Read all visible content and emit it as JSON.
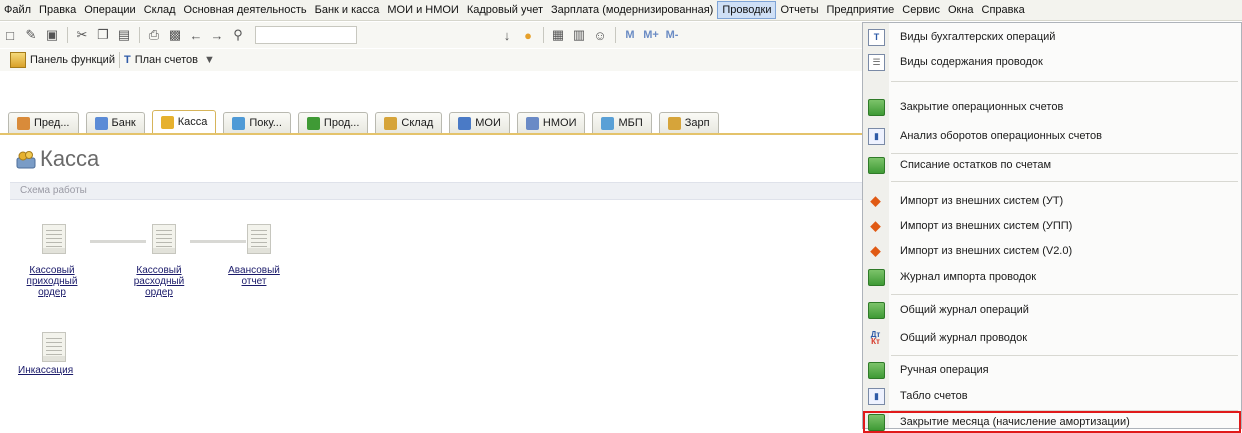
{
  "menubar": {
    "items": [
      "Файл",
      "Правка",
      "Операции",
      "Склад",
      "Основная деятельность",
      "Банк и касса",
      "МОИ и НМОИ",
      "Кадровый учет",
      "Зарплата (модернизированная)",
      "Проводки",
      "Отчеты",
      "Предприятие",
      "Сервис",
      "Окна",
      "Справка"
    ],
    "active": "Проводки"
  },
  "toolbar": {
    "icons": [
      "new-document-icon",
      "open-icon",
      "save-icon",
      "cut-icon",
      "copy-icon",
      "paste-icon",
      "print-icon",
      "preview-icon",
      "back-icon",
      "forward-icon",
      "search-icon",
      "info-icon",
      "calculator-icon",
      "calendar-icon",
      "users-icon"
    ],
    "memory_buttons": [
      "M",
      "M+",
      "M-"
    ]
  },
  "funcbar": {
    "panel_label": "Панель функций",
    "chart_label": "План счетов"
  },
  "tabs": [
    {
      "label": "Пред...",
      "color": "#d98b3a"
    },
    {
      "label": "Банк",
      "color": "#5b8bd6"
    },
    {
      "label": "Касса",
      "color": "#e6b12e"
    },
    {
      "label": "Поку...",
      "color": "#4f9ad6"
    },
    {
      "label": "Прод...",
      "color": "#3f9a35"
    },
    {
      "label": "Склад",
      "color": "#d6a43a"
    },
    {
      "label": "МОИ",
      "color": "#4a7ac6"
    },
    {
      "label": "НМОИ",
      "color": "#6a8ac6"
    },
    {
      "label": "МБП",
      "color": "#5aa0d6"
    },
    {
      "label": "Зарп",
      "color": "#d6a43a"
    }
  ],
  "page": {
    "title": "Касса",
    "schema_label": "Схема работы"
  },
  "schema": {
    "docs": [
      {
        "label": "Кассовый приходный ордер"
      },
      {
        "label": "Кассовый расходный ордер"
      },
      {
        "label": "Авансовый отчет"
      },
      {
        "label": "Инкассация"
      }
    ]
  },
  "dropdown": {
    "items": [
      {
        "label": "Виды бухгалтерских операций",
        "icon": "operation-types-icon"
      },
      {
        "label": "Виды содержания проводок",
        "icon": "document-list-icon"
      },
      {
        "label": "Закрытие операционных счетов",
        "icon": "green-document-icon"
      },
      {
        "label": "Анализ оборотов операционных счетов",
        "icon": "chart-icon"
      },
      {
        "label": "Списание остатков по счетам",
        "icon": "green-document-icon"
      },
      {
        "label": "Импорт из внешних систем (УТ)",
        "icon": "import-icon"
      },
      {
        "label": "Импорт из внешних систем (УПП)",
        "icon": "import-icon"
      },
      {
        "label": "Импорт из внешних систем (V2.0)",
        "icon": "import-icon"
      },
      {
        "label": "Журнал импорта проводок",
        "icon": "green-document-icon"
      },
      {
        "label": "Общий журнал операций",
        "icon": "journal-icon"
      },
      {
        "label": "Общий журнал проводок",
        "icon": "debit-credit-icon"
      },
      {
        "label": "Ручная операция",
        "icon": "green-document-icon"
      },
      {
        "label": "Табло счетов",
        "icon": "chart-icon"
      },
      {
        "label": "Закрытие месяца (начисление амортизации)",
        "icon": "green-document-icon"
      }
    ],
    "debit_credit_glyph": [
      "Дт",
      "Кт"
    ]
  },
  "colors": {
    "highlight": "#e01a1a",
    "active_tab_border": "#e4c36b",
    "menu_active": "#cfe0f6"
  }
}
